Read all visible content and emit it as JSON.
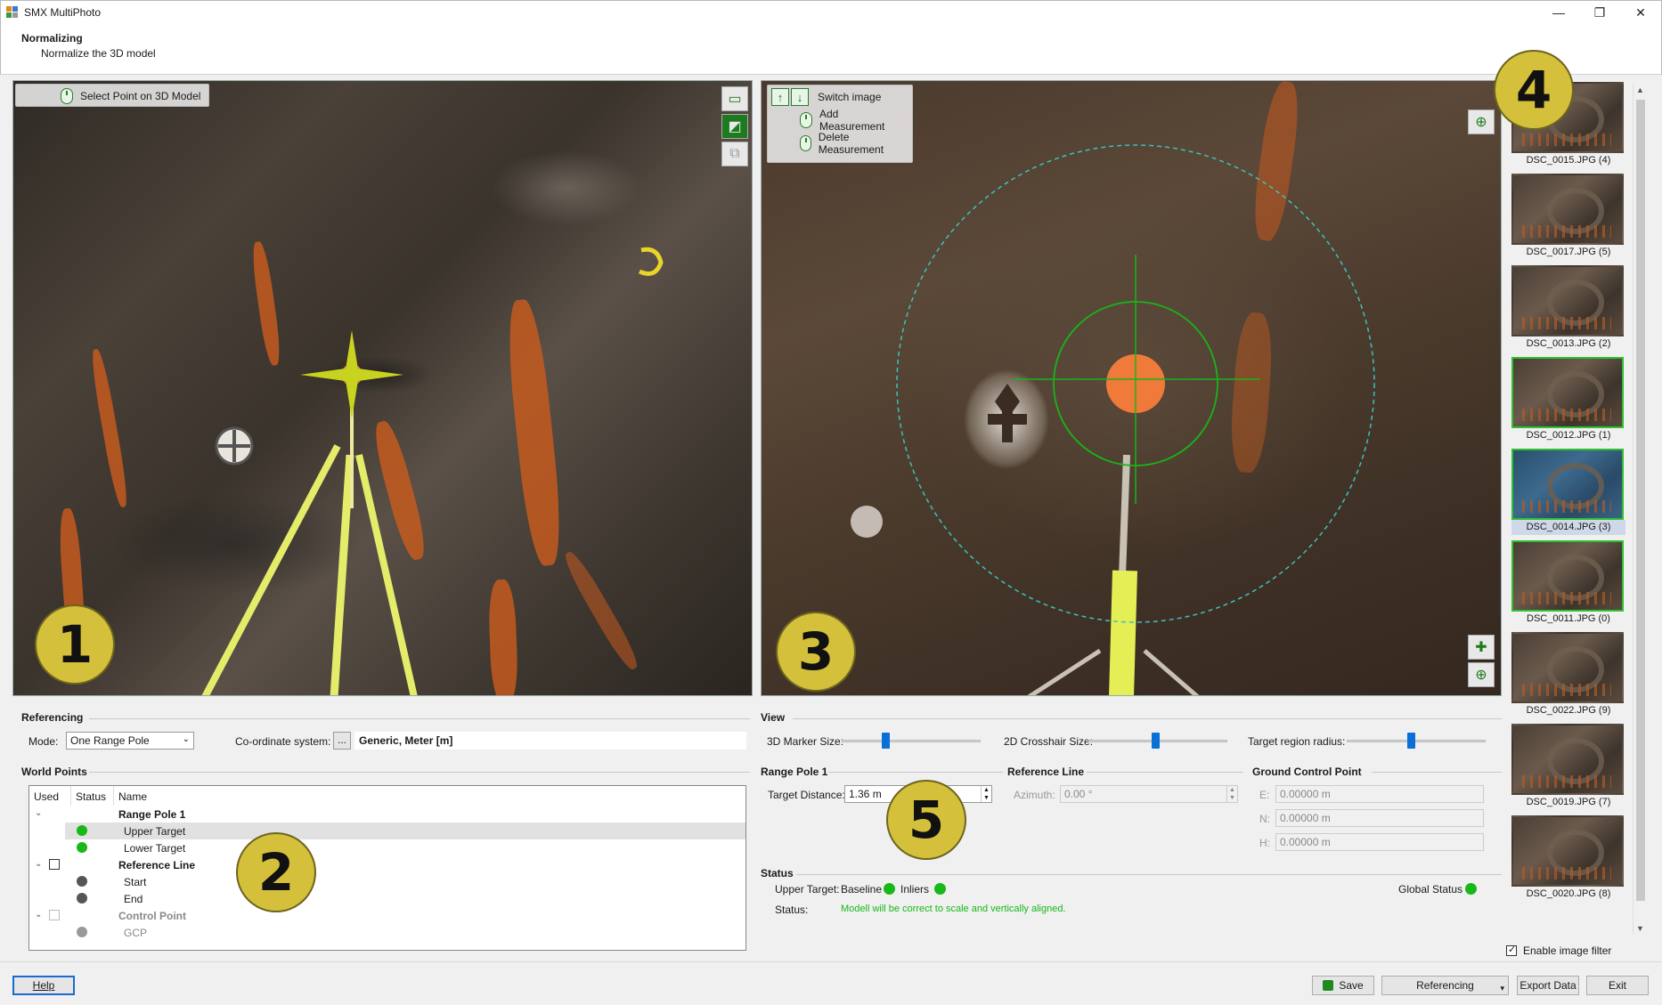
{
  "window": {
    "title": "SMX MultiPhoto",
    "minimize": "—",
    "restore": "❐",
    "close": "✕"
  },
  "header": {
    "title": "Normalizing",
    "subtitle": "Normalize the 3D model"
  },
  "viewer3d": {
    "hint": "Select Point on 3D Model",
    "badge": "1"
  },
  "viewer2d": {
    "hints": {
      "switch": "Switch image",
      "add": "Add Measurement",
      "delete": "Delete Measurement"
    },
    "badge": "3",
    "up": "↑",
    "down": "↓"
  },
  "thumbnails": {
    "badge": "4",
    "items": [
      {
        "label": "DSC_0015.JPG (4)"
      },
      {
        "label": "DSC_0017.JPG (5)"
      },
      {
        "label": "DSC_0013.JPG (2)"
      },
      {
        "label": "DSC_0012.JPG (1)"
      },
      {
        "label": "DSC_0014.JPG (3)"
      },
      {
        "label": "DSC_0011.JPG (0)"
      },
      {
        "label": "DSC_0022.JPG (9)"
      },
      {
        "label": "DSC_0019.JPG (7)"
      },
      {
        "label": "DSC_0020.JPG (8)"
      }
    ],
    "filter_label": "Enable image filter"
  },
  "referencing": {
    "title": "Referencing",
    "mode_label": "Mode:",
    "mode_value": "One Range Pole",
    "coord_label": "Co-ordinate system:",
    "coord_btn": "...",
    "coord_value": "Generic, Meter [m]"
  },
  "world_points": {
    "title": "World Points",
    "badge": "2",
    "columns": {
      "used": "Used",
      "status": "Status",
      "name": "Name"
    },
    "rows": {
      "pole": "Range Pole 1",
      "upper": "Upper Target",
      "lower": "Lower Target",
      "refline": "Reference Line",
      "start": "Start",
      "end": "End",
      "control": "Control Point",
      "gcp": "GCP"
    }
  },
  "view": {
    "title": "View",
    "marker_label": "3D Marker Size:",
    "crosshair_label": "2D Crosshair Size:",
    "radius_label": "Target region radius:"
  },
  "range_pole": {
    "title": "Range Pole 1",
    "distance_label": "Target Distance:",
    "distance_value": "1.36 m",
    "badge": "5"
  },
  "reference_line": {
    "title": "Reference Line",
    "azimuth_label": "Azimuth:",
    "azimuth_value": "0.00 °"
  },
  "gcp": {
    "title": "Ground Control Point",
    "e_label": "E:",
    "e_value": "0.00000 m",
    "n_label": "N:",
    "n_value": "0.00000 m",
    "h_label": "H:",
    "h_value": "0.00000 m"
  },
  "status": {
    "title": "Status",
    "upper_label": "Upper Target:",
    "baseline_label": "Baseline",
    "inliers_label": "Inliers",
    "global_label": "Global Status",
    "status_label": "Status:",
    "message": "Modell will be correct to scale and vertically aligned.",
    "ok_color": "#17b817"
  },
  "footer": {
    "help": "Help",
    "save": "Save",
    "referencing": "Referencing",
    "export": "Export Data",
    "exit": "Exit"
  }
}
